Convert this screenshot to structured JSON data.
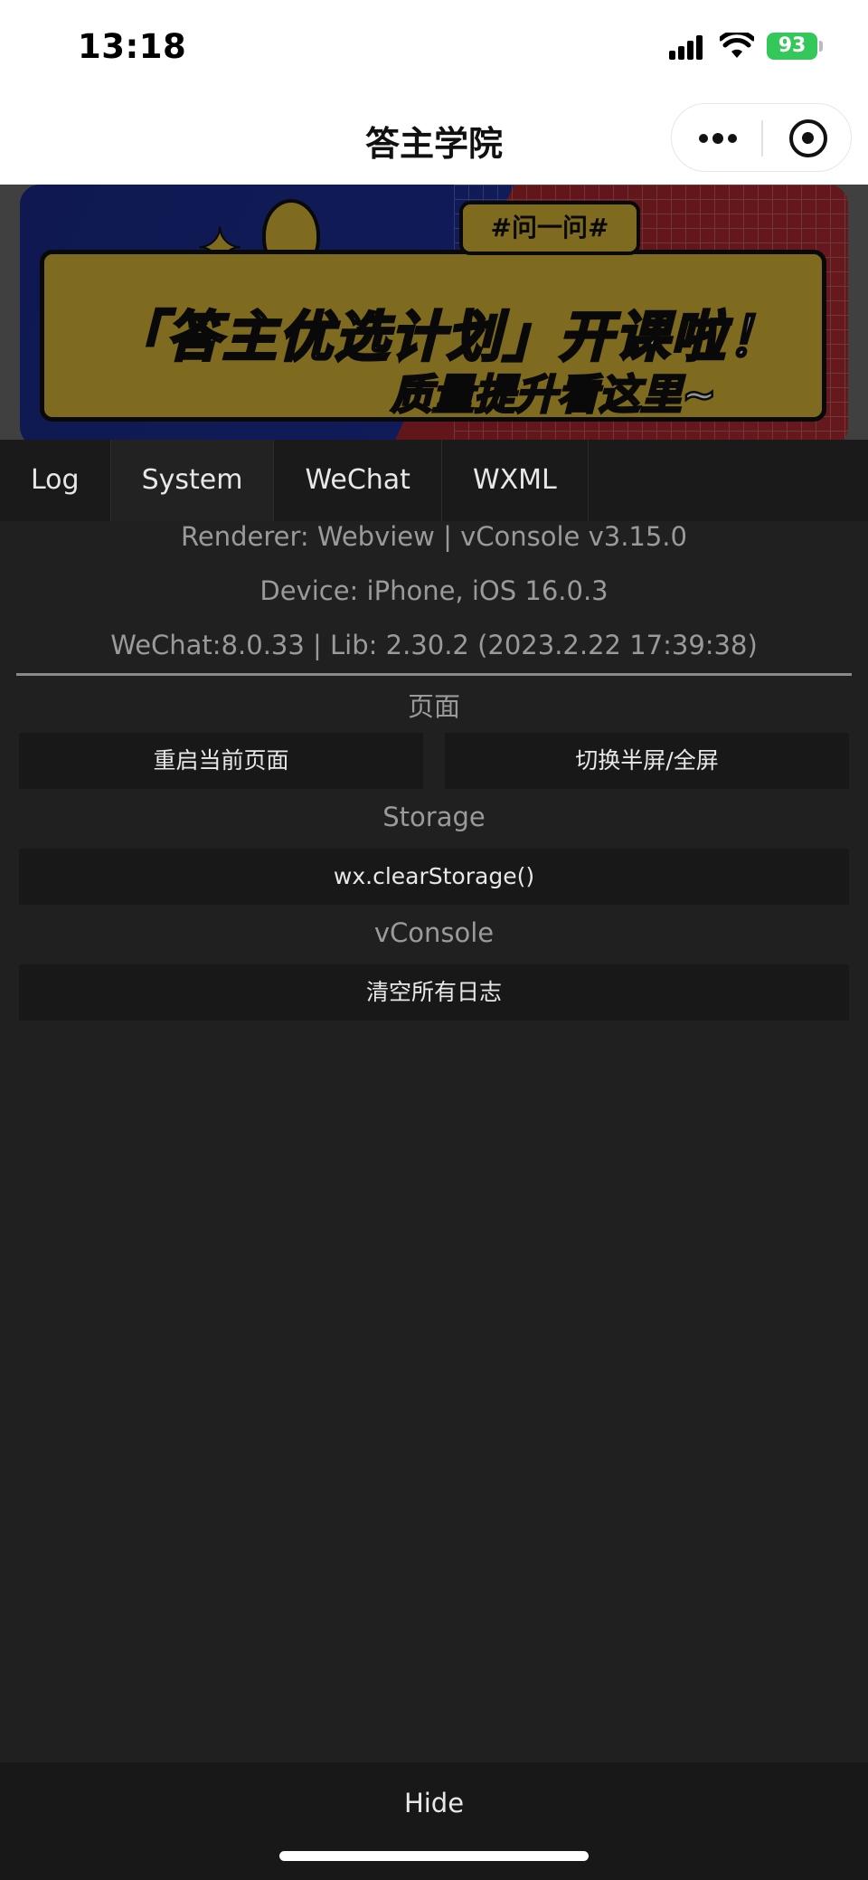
{
  "status_bar": {
    "time": "13:18",
    "battery": "93"
  },
  "nav": {
    "title": "答主学院"
  },
  "banner": {
    "tag": "#问一问#",
    "line1": "「答主优选计划」开课啦！",
    "line2": "质量提升看这里~"
  },
  "tabs": [
    {
      "label": "Log"
    },
    {
      "label": "System"
    },
    {
      "label": "WeChat"
    },
    {
      "label": "WXML"
    }
  ],
  "info": {
    "renderer": "Renderer: Webview | vConsole v3.15.0",
    "device": "Device: iPhone, iOS 16.0.3",
    "wechat": "WeChat:8.0.33 | Lib: 2.30.2 (2023.2.22 17:39:38)"
  },
  "sections": {
    "page": {
      "title": "页面",
      "restart": "重启当前页面",
      "toggle": "切换半屏/全屏"
    },
    "storage": {
      "title": "Storage",
      "clear": "wx.clearStorage()"
    },
    "vconsole": {
      "title": "vConsole",
      "clear_logs": "清空所有日志"
    }
  },
  "footer": {
    "hide": "Hide"
  }
}
